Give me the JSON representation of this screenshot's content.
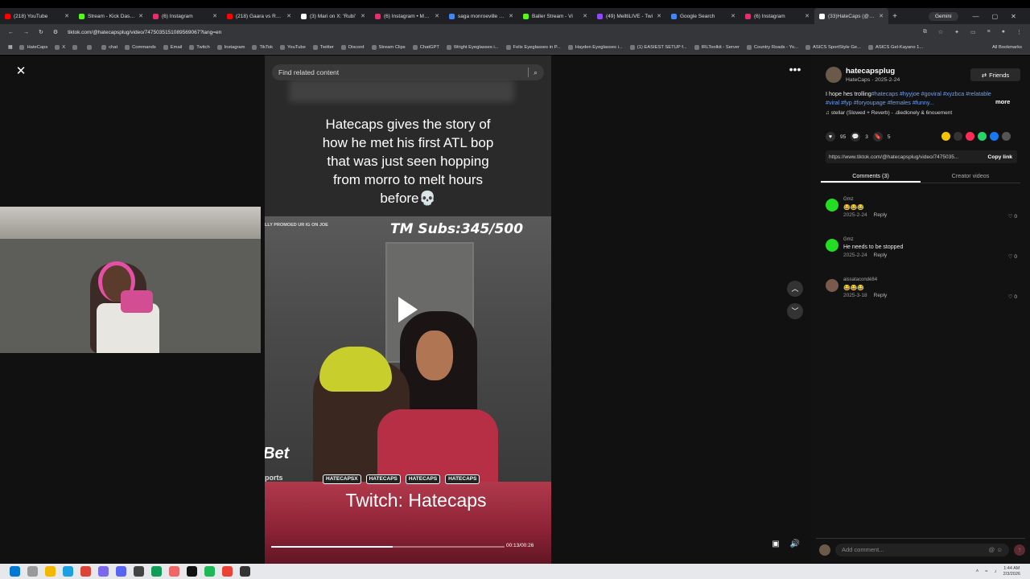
{
  "tabs": [
    {
      "label": "(218) YouTube",
      "color": "#ff0000",
      "active": false
    },
    {
      "label": "Stream - Kick Dashbo",
      "color": "#53fc18",
      "active": false
    },
    {
      "label": "(6) Instagram",
      "color": "#e1306c",
      "active": false
    },
    {
      "label": "(218) Gaara vs Rock",
      "color": "#ff0000",
      "active": false
    },
    {
      "label": "(3) Mari on X: 'Rubi'",
      "color": "#ffffff",
      "active": false
    },
    {
      "label": "(6) Instagram • Mess",
      "color": "#e1306c",
      "active": false
    },
    {
      "label": "saga monroeville - G",
      "color": "#4285f4",
      "active": false
    },
    {
      "label": "Baller Stream - Vi",
      "color": "#53fc18",
      "active": false
    },
    {
      "label": "(49) MelltiLIVE - Twi",
      "color": "#9146ff",
      "active": false
    },
    {
      "label": "Google Search",
      "color": "#4285f4",
      "active": false
    },
    {
      "label": "(6) Instagram",
      "color": "#e1306c",
      "active": false
    },
    {
      "label": "(33)HateCaps (@hat",
      "color": "#ffffff",
      "active": true
    }
  ],
  "gemini_label": "Gemini",
  "url": "tiktok.com/@hatecapsplug/video/7475035151089569067?lang=en",
  "bookmarks": [
    "HateCaps",
    "X",
    "",
    "",
    "chat",
    "Commands",
    "Email",
    "Twitch",
    "Instagram",
    "TikTok",
    "YouTube",
    "Twitter",
    "Discord",
    "Stream Clips",
    "ChatGPT",
    "Wright Eyeglasses i...",
    "Felix Eyeglasses in P...",
    "Hayden Eyeglasses i...",
    "(1) EASIEST SETUP f...",
    "IRLToolkit - Server",
    "Country Roads - Yo...",
    "ASICS SportStyle Ge...",
    "ASICS Gel-Kayano 1..."
  ],
  "all_bookmarks": "All Bookmarks",
  "search": {
    "placeholder": "Find related content"
  },
  "video": {
    "caption": "Hatecaps gives the story of how he met his first ATL bop that was just seen hopping from morro to melt hours before💀",
    "promo": "LLY PROMOED UR IG ON JOE",
    "subs": "TM Subs:345/500",
    "handles": [
      "HATECAPSX",
      "HATECAPS",
      "HATECAPS",
      "HATECAPS"
    ],
    "bet": "Bet",
    "ports": "ports",
    "twitch": "Twitch: Hatecaps",
    "time": "00:13/00:26",
    "progress": 0.52
  },
  "panel": {
    "username": "hatecapsplug",
    "subline": "HateCaps · 2025-2-24",
    "friends": "Friends",
    "desc_text": "I hope hes trolling",
    "desc_tags": "#hatecaps #hyyjoe #goviral #xyzbca #relatable #viral #fyp #foryoupage #females #funny...",
    "more": "more",
    "music": "stellar (Slowed + Reverb) - .diedlonely & 6nouement",
    "likes": "95",
    "comments_count": "3",
    "saves": "5",
    "link": "https://www.tiktok.com/@hatecapsplug/video/7475035...",
    "copy_link": "Copy link",
    "tab_comments": "Comments (3)",
    "tab_creator": "Creator videos",
    "comments": [
      {
        "name": "Gmz",
        "text": "😂😂😂",
        "date": "2025-2-24",
        "reply": "Reply",
        "likes": "0",
        "color": "#22dd22"
      },
      {
        "name": "Gmz",
        "text": "He needs to be stopped",
        "date": "2025-2-24",
        "reply": "Reply",
        "likes": "0",
        "color": "#22dd22"
      },
      {
        "name": "aissatacondé84",
        "text": "😂😂😂",
        "date": "2025-3-18",
        "reply": "Reply",
        "likes": "0",
        "color": "#7a5a4a"
      }
    ],
    "add_comment": "Add comment..."
  },
  "clock": {
    "time": "1:44 AM",
    "date": "2/3/2026"
  }
}
